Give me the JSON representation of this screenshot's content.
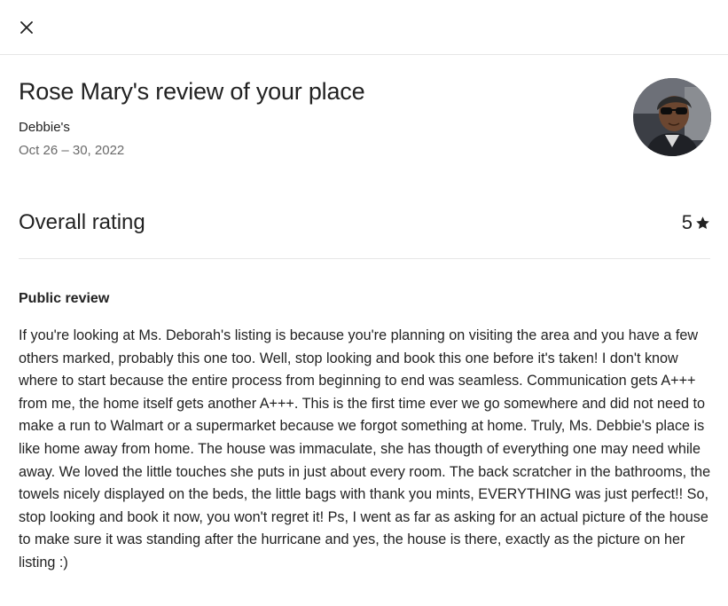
{
  "header": {
    "close_icon": "close-icon"
  },
  "review": {
    "title": "Rose Mary's review of your place",
    "listing": "Debbie's",
    "dates": "Oct 26 – 30, 2022",
    "avatar_icon": "reviewer-avatar-photo"
  },
  "rating": {
    "label": "Overall rating",
    "value": "5",
    "star_icon": "star-icon"
  },
  "public_review": {
    "heading": "Public review",
    "text": "If you're looking at Ms. Deborah's listing is because you're planning on visiting the area and you have a few others marked, probably this one too. Well, stop looking and book this one before it's taken! I don't know where to start because the entire process from beginning to end was seamless. Communication gets A+++ from me, the home itself gets another A+++. This is the first time ever we go somewhere and did not need to make a run to Walmart or a supermarket because we forgot something at home. Truly, Ms. Debbie's place is like home away from home. The house was immaculate, she has thougth of everything one may need while away. We loved the little touches she puts in just about every room. The back scratcher in the bathrooms, the towels nicely displayed on the beds, the little bags with thank you mints, EVERYTHING was just perfect!! So, stop looking and book it now, you won't regret it! Ps, I went as far as asking for an actual picture of the house to make sure it was standing after the hurricane and yes, the house is there, exactly as the picture on her listing :)"
  }
}
